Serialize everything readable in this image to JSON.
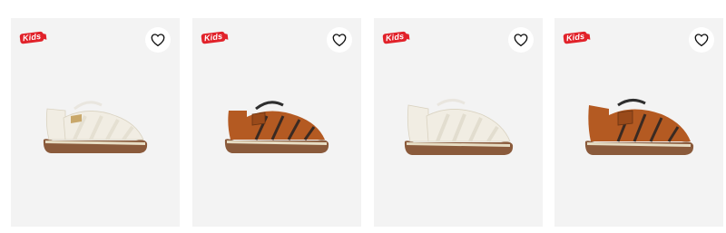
{
  "products": [
    {
      "badge": "Kids",
      "icon": "heart-outline-icon",
      "colorway": "white"
    },
    {
      "badge": "Kids",
      "icon": "heart-outline-icon",
      "colorway": "brown"
    },
    {
      "badge": "Kids",
      "icon": "heart-outline-icon",
      "colorway": "white"
    },
    {
      "badge": "Kids",
      "icon": "heart-outline-icon",
      "colorway": "brown"
    }
  ],
  "colors": {
    "card_bg": "#f3f3f3",
    "badge_red": "#e1222a",
    "sole_brown": "#8a5a3b",
    "upper_white": "#efeadc",
    "upper_brown": "#b45a22"
  }
}
